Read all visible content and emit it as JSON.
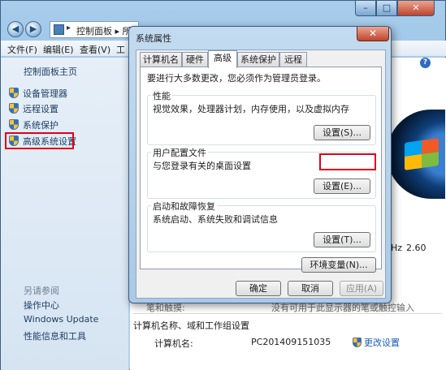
{
  "control_panel": {
    "breadcrumb_arrow": "▸",
    "breadcrumb": "控制面板 ▸ 所",
    "menu": [
      "文件(F)",
      "编辑(E)",
      "查看(V)",
      "工"
    ],
    "window_controls": {
      "minimize": "–",
      "maximize": "□",
      "close": "✕"
    },
    "sidebar": {
      "home": "控制面板主页",
      "links": [
        "设备管理器",
        "远程设置",
        "系统保护",
        "高级系统设置"
      ],
      "see_also_title": "另请参阅",
      "see_also": [
        "操作中心",
        "Windows Update",
        "性能信息和工具"
      ]
    },
    "main": {
      "help": "?",
      "cpu_unit": "Hz",
      "cpu_speed": "2.60",
      "pen_label": "笔和触摸:",
      "pen_value": "没有可用于此显示器的笔或触控输入",
      "section_title": "计算机名称、域和工作组设置",
      "computer_name_label": "计算机名:",
      "computer_name_value": "PC201409151035",
      "change_settings": "更改设置"
    }
  },
  "dialog": {
    "title": "系统属性",
    "close": "✕",
    "tabs": [
      "计算机名",
      "硬件",
      "高级",
      "系统保护",
      "远程"
    ],
    "active_tab": "高级",
    "admin_note": "要进行大多数更改，您必须作为管理员登录。",
    "groups": [
      {
        "title": "性能",
        "desc": "视觉效果，处理器计划，内存使用，以及虚拟内存",
        "button": "设置(S)..."
      },
      {
        "title": "用户配置文件",
        "desc": "与您登录有关的桌面设置",
        "button": "设置(E)..."
      },
      {
        "title": "启动和故障恢复",
        "desc": "系统启动、系统失败和调试信息",
        "button": "设置(T)..."
      }
    ],
    "env_button": "环境变量(N)...",
    "ok": "确定",
    "cancel": "取消",
    "apply": "应用(A)"
  },
  "colors": {
    "highlight": "#e0001a",
    "link": "#1e5fb4"
  }
}
